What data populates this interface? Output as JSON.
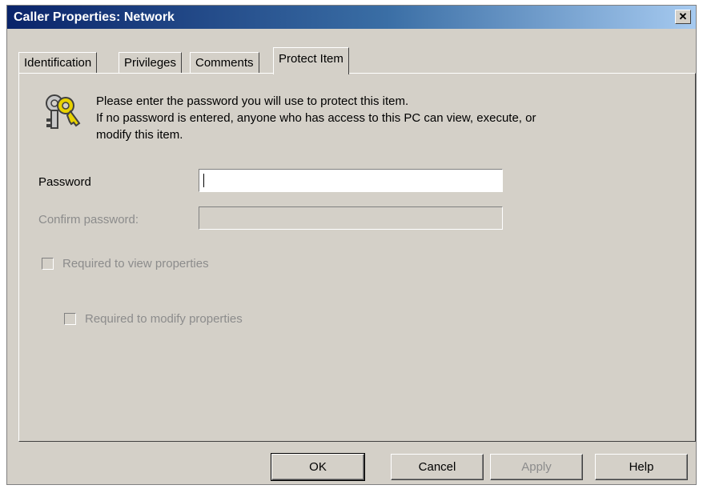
{
  "window": {
    "title": "Caller Properties: Network",
    "close_glyph": "✕"
  },
  "tabs": [
    {
      "label": "Identification",
      "active": false
    },
    {
      "label": "Privileges",
      "active": false
    },
    {
      "label": "Comments",
      "active": false
    },
    {
      "label": "Protect Item",
      "active": true
    }
  ],
  "info": {
    "icon": "keys-icon",
    "line1": "Please enter the password you will use to protect this item.",
    "line2": "If no password is entered, anyone who has access to this PC can view, execute, or",
    "line3": "modify this item."
  },
  "form": {
    "password_label": "Password",
    "password_value": "",
    "confirm_label": "Confirm password:",
    "confirm_value": "",
    "confirm_enabled": false,
    "chk_view_label": "Required to view properties",
    "chk_view_checked": false,
    "chk_view_enabled": false,
    "chk_modify_label": "Required to modify properties",
    "chk_modify_checked": false,
    "chk_modify_enabled": false
  },
  "buttons": {
    "ok": "OK",
    "cancel": "Cancel",
    "apply": "Apply",
    "help": "Help",
    "apply_enabled": false
  },
  "colors": {
    "title_bar_start": "#0a246a",
    "title_bar_end": "#a6caf0",
    "face": "#d4d0c8",
    "disabled_text": "#8c8c8c"
  }
}
